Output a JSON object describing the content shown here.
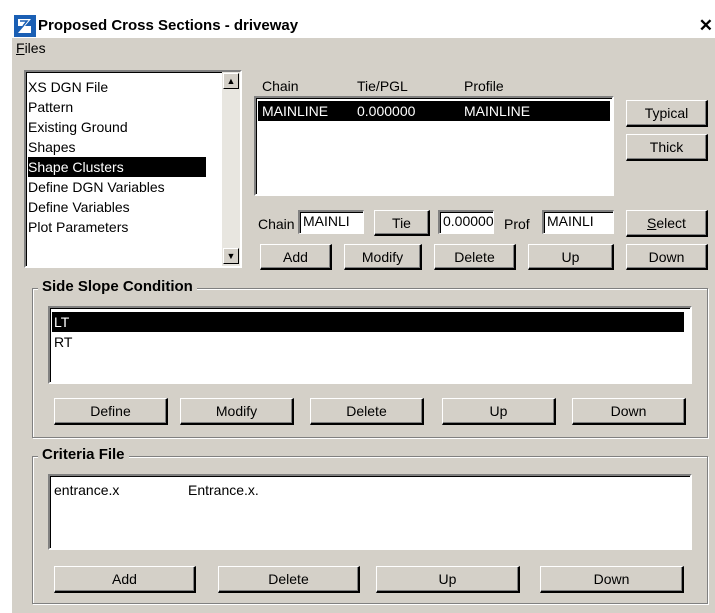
{
  "window": {
    "title": "Proposed Cross Sections - driveway",
    "close_glyph": "✕"
  },
  "menu": {
    "files_mnemonic": "F",
    "files_rest": "iles"
  },
  "nav_list": {
    "items": [
      "XS DGN File",
      "Pattern",
      "Existing Ground",
      "Shapes",
      "Shape Clusters",
      "Define DGN Variables",
      "Define Variables",
      "Plot Parameters"
    ],
    "selected": "Shape Clusters"
  },
  "chain_table": {
    "headers": {
      "chain": "Chain",
      "tie": "Tie/PGL",
      "profile": "Profile"
    },
    "rows": [
      {
        "chain": "MAINLINE",
        "tie": "0.000000",
        "profile": "MAINLINE"
      }
    ]
  },
  "side_buttons": {
    "typical": "Typical",
    "thick": "Thick"
  },
  "chain_edit": {
    "chain_label": "Chain",
    "chain_value": "MAINLI",
    "tie_button": "Tie",
    "tie_value": "0.00000(",
    "prof_label": "Prof",
    "prof_value": "MAINLI",
    "select_mnemonic": "S",
    "select_rest": "elect"
  },
  "chain_buttons": {
    "add": "Add",
    "modify": "Modify",
    "delete": "Delete",
    "up": "Up",
    "down": "Down"
  },
  "side_slope": {
    "title": "Side Slope Condition",
    "items": [
      "LT",
      "RT"
    ],
    "selected": "LT",
    "buttons": {
      "define": "Define",
      "modify": "Modify",
      "delete": "Delete",
      "up": "Up",
      "down": "Down"
    }
  },
  "criteria": {
    "title": "Criteria File",
    "rows": [
      {
        "file": "entrance.x",
        "name": "Entrance.x."
      }
    ],
    "buttons": {
      "add": "Add",
      "delete": "Delete",
      "up": "Up",
      "down": "Down"
    }
  },
  "colors": {
    "dialog_bg": "#d4d0c8",
    "selection": "#000000",
    "logo_blue": "#1a5fb4"
  }
}
